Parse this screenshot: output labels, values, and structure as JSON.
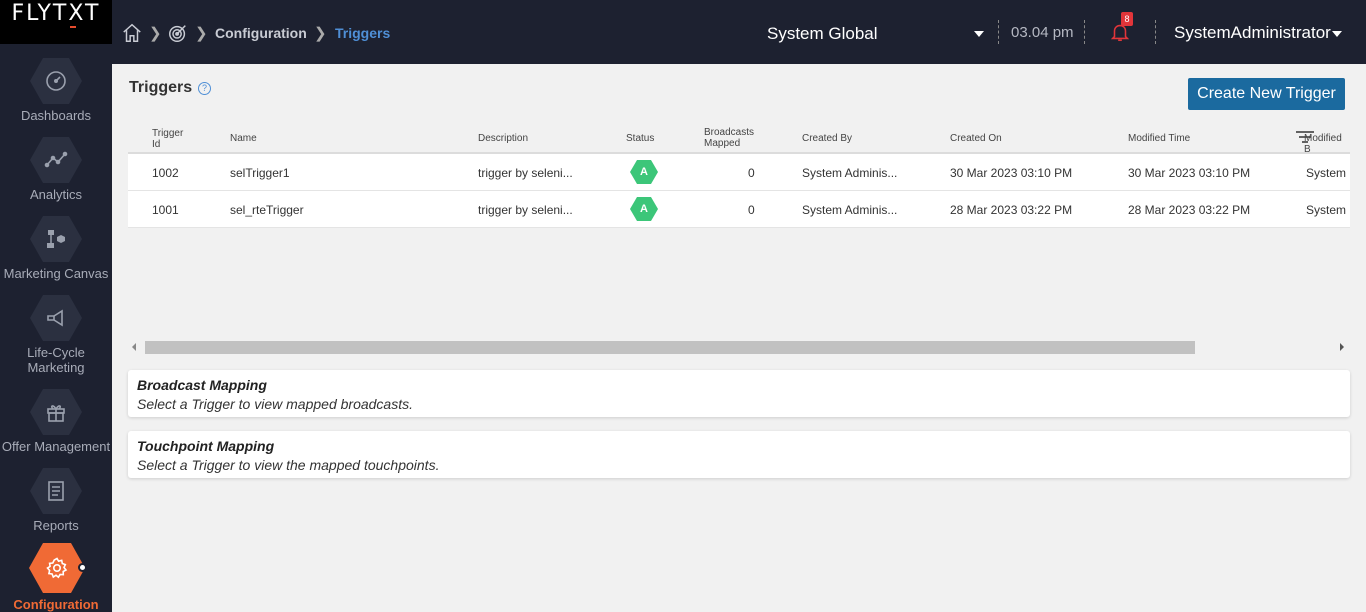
{
  "app": {
    "logo": "FLYTXT"
  },
  "sidebar": {
    "items": [
      {
        "label": "Dashboards",
        "icon": "gauge-icon"
      },
      {
        "label": "Analytics",
        "icon": "line-chart-icon"
      },
      {
        "label": "Marketing Canvas",
        "icon": "flow-icon"
      },
      {
        "label": "Life-Cycle Marketing",
        "icon": "megaphone-icon"
      },
      {
        "label": "Offer Management",
        "icon": "gift-icon"
      },
      {
        "label": "Reports",
        "icon": "report-icon"
      },
      {
        "label": "Configuration",
        "icon": "gear-icon",
        "active": true
      }
    ]
  },
  "header": {
    "breadcrumb": [
      "Configuration",
      "Triggers"
    ],
    "scope": "System Global",
    "time": "03.04 pm",
    "notifications": "8",
    "user": "SystemAdministrator"
  },
  "page": {
    "title": "Triggers",
    "create_button": "Create New Trigger"
  },
  "table": {
    "headers": {
      "id_line1": "Trigger",
      "id_line2": "Id",
      "name": "Name",
      "description": "Description",
      "status": "Status",
      "broadcasts_line1": "Broadcasts",
      "broadcasts_line2": "Mapped",
      "created_by": "Created By",
      "created_on": "Created On",
      "modified_time": "Modified Time",
      "modified_by": "Modified B"
    },
    "rows": [
      {
        "id": "1002",
        "name": "selTrigger1",
        "description": "trigger by seleni...",
        "status": "A",
        "broadcasts": "0",
        "created_by": "System Adminis...",
        "created_on": "30 Mar 2023 03:10 PM",
        "modified_time": "30 Mar 2023 03:10 PM",
        "modified_by": "System ..."
      },
      {
        "id": "1001",
        "name": "sel_rteTrigger",
        "description": "trigger by seleni...",
        "status": "A",
        "broadcasts": "0",
        "created_by": "System Adminis...",
        "created_on": "28 Mar 2023 03:22 PM",
        "modified_time": "28 Mar 2023 03:22 PM",
        "modified_by": "System ..."
      }
    ]
  },
  "panels": {
    "broadcast": {
      "title": "Broadcast Mapping",
      "subtitle": "Select a Trigger to view mapped broadcasts."
    },
    "touchpoint": {
      "title": "Touchpoint Mapping",
      "subtitle": "Select a Trigger to view the mapped touchpoints."
    }
  },
  "colors": {
    "sidebar": "#1d2130",
    "accent": "#f06a35",
    "link": "#4f8fd6",
    "button": "#1b6a9f",
    "status_active": "#3cc679",
    "badge": "#e2353a"
  }
}
